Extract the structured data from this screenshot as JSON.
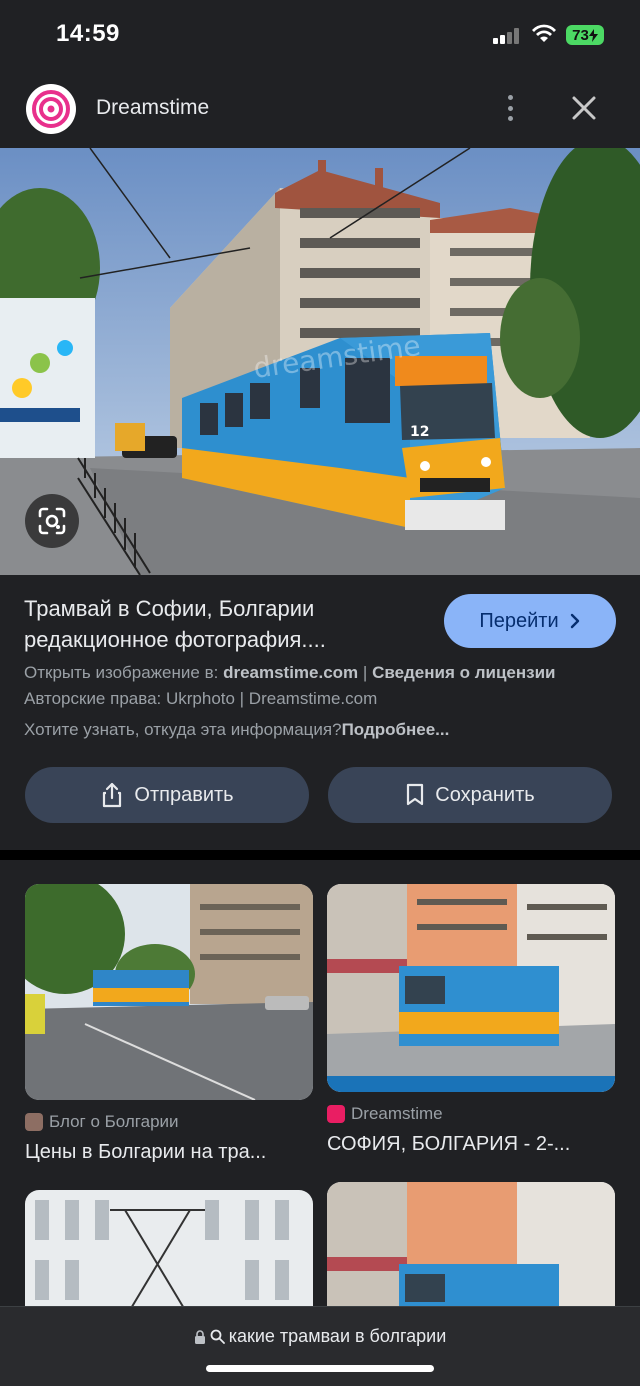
{
  "status_bar": {
    "time": "14:59",
    "battery": "73"
  },
  "header": {
    "source_name": "Dreamstime"
  },
  "image_watermark": "dreamstime",
  "detail": {
    "title": "Трамвай в Софии, Болгарии редакционное фотография....",
    "visit_button": "Перейти",
    "open_in_prefix": "Открыть изображение в: ",
    "open_in_site": "dreamstime.com",
    "separator": " | ",
    "license_link": "Сведения о лицензии",
    "copyright": "Авторские права: Ukrphoto | Dreamstime.com",
    "info_question": "Хотите узнать, откуда эта информация?",
    "more_link": "Подробнее..."
  },
  "actions": {
    "share": "Отправить",
    "save": "Сохранить"
  },
  "related": [
    {
      "source": "Блог о Болгарии",
      "title": "Цены в Болгарии на тра...",
      "favicon_color": "#8d6e63"
    },
    {
      "source": "Dreamstime",
      "title": "СОФИЯ, БОЛГАРИЯ - 2-...",
      "favicon_color": "#e91e63"
    }
  ],
  "bottom": {
    "url": "какие трамваи в болгарии"
  },
  "colors": {
    "background": "#202124",
    "accent_button": "#8ab4f8",
    "action_button": "#394457"
  }
}
